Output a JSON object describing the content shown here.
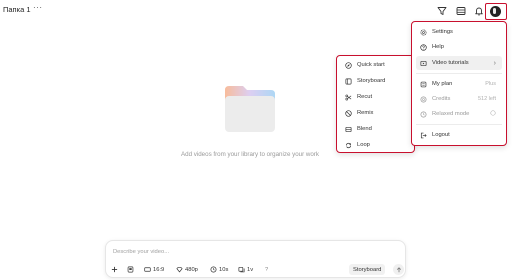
{
  "topbar": {
    "folder_title": "Папка 1",
    "more_label": "···",
    "icons": [
      "filter-icon",
      "storage-icon",
      "bell-icon"
    ]
  },
  "account_menu": {
    "items": [
      {
        "icon": "gear-icon",
        "label": "Settings"
      },
      {
        "icon": "help-icon",
        "label": "Help"
      },
      {
        "icon": "video-icon",
        "label": "Video tutorials",
        "has_submenu": true
      },
      {
        "icon": "plan-icon",
        "label": "My plan",
        "value": "Plus"
      },
      {
        "icon": "credits-icon",
        "label": "Credits",
        "value": "512 left"
      },
      {
        "icon": "relax-icon",
        "label": "Relaxed mode"
      },
      {
        "icon": "logout-icon",
        "label": "Logout"
      }
    ]
  },
  "tutorials_submenu": {
    "items": [
      {
        "icon": "compass-icon",
        "label": "Quick start"
      },
      {
        "icon": "storyboard-icon",
        "label": "Storyboard"
      },
      {
        "icon": "scissors-icon",
        "label": "Recut"
      },
      {
        "icon": "remix-icon",
        "label": "Remix"
      },
      {
        "icon": "blend-icon",
        "label": "Blend"
      },
      {
        "icon": "loop-icon",
        "label": "Loop"
      }
    ]
  },
  "empty_state": {
    "message": "Add videos from your library to organize your work"
  },
  "composer": {
    "placeholder": "Describe your video...",
    "aspect": "16:9",
    "resolution": "480p",
    "duration": "10s",
    "variations": "1v",
    "help": "?",
    "storyboard_label": "Storyboard"
  },
  "colors": {
    "highlight_outline": "#c8102e",
    "menu_hover": "#f0f0f0"
  }
}
